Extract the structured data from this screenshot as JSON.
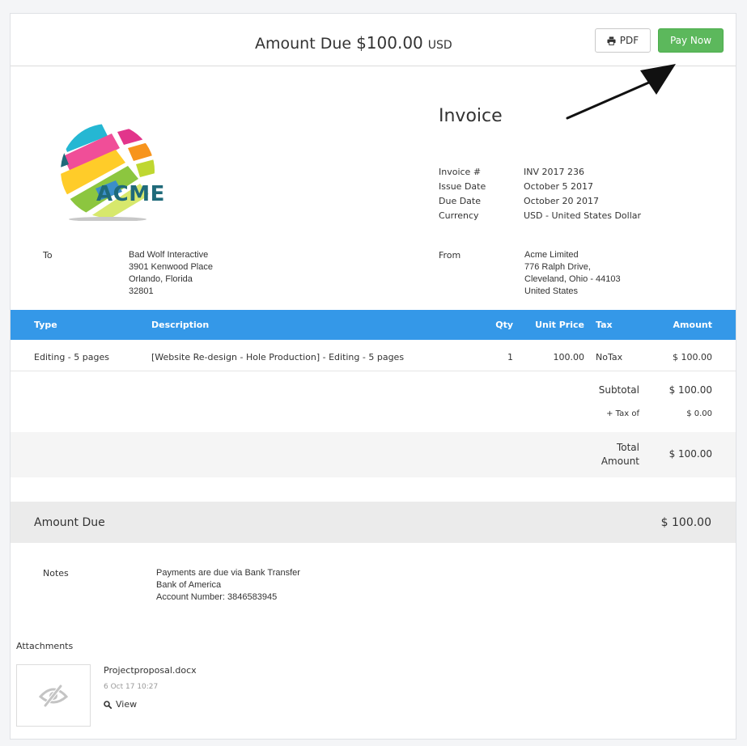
{
  "header": {
    "amount_due_label": "Amount Due",
    "amount_due_value": "$100.00",
    "currency_code": "USD",
    "pdf_label": "PDF",
    "pay_now_label": "Pay Now"
  },
  "logo": {
    "text": "ACME"
  },
  "invoice": {
    "title": "Invoice",
    "meta": [
      {
        "label": "Invoice #",
        "value": "INV 2017 236"
      },
      {
        "label": "Issue Date",
        "value": "October 5 2017"
      },
      {
        "label": "Due Date",
        "value": "October 20 2017"
      },
      {
        "label": "Currency",
        "value": "USD - United States Dollar"
      }
    ]
  },
  "to": {
    "label": "To",
    "lines": [
      "Bad Wolf Interactive",
      "3901 Kenwood Place",
      "Orlando, Florida",
      "32801"
    ]
  },
  "from": {
    "label": "From",
    "lines": [
      "Acme Limited",
      "776 Ralph Drive,",
      "Cleveland, Ohio - 44103",
      "United States"
    ]
  },
  "table": {
    "headers": {
      "type": "Type",
      "description": "Description",
      "qty": "Qty",
      "unit_price": "Unit Price",
      "tax": "Tax",
      "amount": "Amount"
    },
    "rows": [
      {
        "type": "Editing - 5 pages",
        "description": "[Website Re-design - Hole Production] - Editing - 5 pages",
        "qty": "1",
        "unit_price": "100.00",
        "tax": "NoTax",
        "amount": "$ 100.00"
      }
    ]
  },
  "summary": {
    "subtotal_label": "Subtotal",
    "subtotal_value": "$ 100.00",
    "tax_label": "+ Tax of",
    "tax_value": "$ 0.00",
    "total_label_1": "Total",
    "total_label_2": "Amount",
    "total_value": "$ 100.00"
  },
  "amount_due": {
    "label": "Amount Due",
    "value": "$ 100.00"
  },
  "notes": {
    "label": "Notes",
    "lines": [
      "Payments are due via Bank Transfer",
      "Bank of America",
      "Account Number: 3846583945"
    ]
  },
  "attachments": {
    "label": "Attachments",
    "files": [
      {
        "name": "Projectproposal.docx",
        "date": "6 Oct 17 10:27",
        "view_label": "View",
        "icon": "eye-slash-icon"
      }
    ]
  },
  "colors": {
    "table_header": "#3498e8",
    "pay_button": "#5cb85c",
    "logo_text": "#1f6a7a"
  }
}
